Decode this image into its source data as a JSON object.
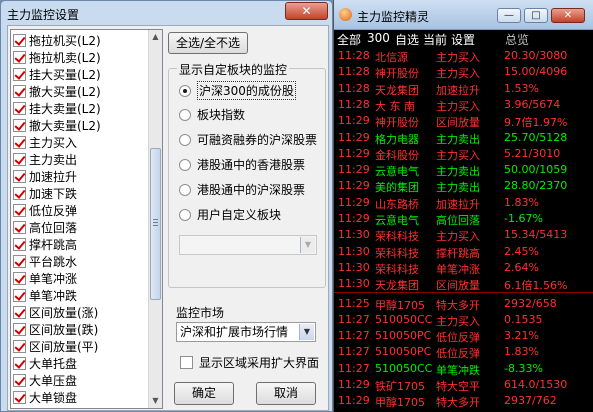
{
  "dialog": {
    "title": "主力监控设置",
    "close_glyph": "✕",
    "checklist": [
      {
        "label": "拖拉机买(L2)",
        "checked": true
      },
      {
        "label": "拖拉机卖(L2)",
        "checked": true
      },
      {
        "label": "挂大买量(L2)",
        "checked": true
      },
      {
        "label": "撤大买量(L2)",
        "checked": true
      },
      {
        "label": "挂大卖量(L2)",
        "checked": true
      },
      {
        "label": "撤大卖量(L2)",
        "checked": true
      },
      {
        "label": "主力买入",
        "checked": true
      },
      {
        "label": "主力卖出",
        "checked": true
      },
      {
        "label": "加速拉升",
        "checked": true
      },
      {
        "label": "加速下跌",
        "checked": true
      },
      {
        "label": "低位反弹",
        "checked": true
      },
      {
        "label": "高位回落",
        "checked": true
      },
      {
        "label": "撑杆跳高",
        "checked": true
      },
      {
        "label": "平台跳水",
        "checked": true
      },
      {
        "label": "单笔冲涨",
        "checked": true
      },
      {
        "label": "单笔冲跌",
        "checked": true
      },
      {
        "label": "区间放量(涨)",
        "checked": true
      },
      {
        "label": "区间放量(跌)",
        "checked": true
      },
      {
        "label": "区间放量(平)",
        "checked": true
      },
      {
        "label": "大单托盘",
        "checked": true
      },
      {
        "label": "大单压盘",
        "checked": true
      },
      {
        "label": "大单锁盘",
        "checked": true
      }
    ],
    "select_all_button": "全选/全不选",
    "block_group": {
      "title": "显示自定板块的监控",
      "options": [
        {
          "label": "沪深300的成份股",
          "selected": true
        },
        {
          "label": "板块指数",
          "selected": false
        },
        {
          "label": "可融资融券的沪深股票",
          "selected": false
        },
        {
          "label": "港股通中的香港股票",
          "selected": false
        },
        {
          "label": "港股通中的沪深股票",
          "selected": false
        },
        {
          "label": "用户自定义板块",
          "selected": false
        }
      ],
      "custom_block_value": ""
    },
    "market": {
      "label": "监控市场",
      "value": "沪深和扩展市场行情"
    },
    "enlarge_checkbox": {
      "label": "显示区域采用扩大界面",
      "checked": false
    },
    "ok_button": "确定",
    "cancel_button": "取消"
  },
  "monitor": {
    "title": "主力监控精灵",
    "min_glyph": "—",
    "max_glyph": "□",
    "close_glyph": "✕",
    "tabs": [
      "全部",
      "300",
      "自选",
      "当前",
      "设置"
    ],
    "column_header": "总览",
    "rows": [
      {
        "time": "11:28",
        "name": "北信源",
        "signal": "主力买入",
        "value": "20.30/3080",
        "color": "red"
      },
      {
        "time": "11:28",
        "name": "神开股份",
        "signal": "主力买入",
        "value": "15.00/4096",
        "color": "red"
      },
      {
        "time": "11:28",
        "name": "天龙集团",
        "signal": "加速拉升",
        "value": "1.53%",
        "color": "red"
      },
      {
        "time": "11:28",
        "name": "大 东 南",
        "signal": "主力买入",
        "value": "3.96/5674",
        "color": "red"
      },
      {
        "time": "11:29",
        "name": "神开股份",
        "signal": "区间放量",
        "value": "9.7倍1.97%",
        "color": "red"
      },
      {
        "time": "11:29",
        "name": "格力电器",
        "signal": "主力卖出",
        "value": "25.70/5128",
        "color": "green"
      },
      {
        "time": "11:29",
        "name": "金科股份",
        "signal": "主力买入",
        "value": "5.21/3010",
        "color": "red"
      },
      {
        "time": "11:29",
        "name": "云意电气",
        "signal": "主力卖出",
        "value": "50.00/1059",
        "color": "green"
      },
      {
        "time": "11:29",
        "name": "美的集团",
        "signal": "主力卖出",
        "value": "28.80/2370",
        "color": "green"
      },
      {
        "time": "11:29",
        "name": "山东路桥",
        "signal": "加速拉升",
        "value": "1.83%",
        "color": "red"
      },
      {
        "time": "11:29",
        "name": "云意电气",
        "signal": "高位回落",
        "value": "-1.67%",
        "color": "green"
      },
      {
        "time": "11:30",
        "name": "荣科科技",
        "signal": "主力买入",
        "value": "15.34/5413",
        "color": "red"
      },
      {
        "time": "11:30",
        "name": "荣科科技",
        "signal": "撑杆跳高",
        "value": "2.45%",
        "color": "red"
      },
      {
        "time": "11:30",
        "name": "荣科科技",
        "signal": "单笔冲涨",
        "value": "2.64%",
        "color": "red"
      },
      {
        "time": "11:30",
        "name": "天龙集团",
        "signal": "区间放量",
        "value": "6.1倍1.56%",
        "color": "red"
      },
      {
        "time": "11:25",
        "name": "甲醇1705",
        "signal": "特大多开",
        "value": "2932/658",
        "color": "red"
      },
      {
        "time": "11:27",
        "name": "510050CC",
        "signal": "主力买入",
        "value": "0.1535",
        "color": "red"
      },
      {
        "time": "11:27",
        "name": "510050PC",
        "signal": "低位反弹",
        "value": "3.21%",
        "color": "red"
      },
      {
        "time": "11:27",
        "name": "510050PC",
        "signal": "低位反弹",
        "value": "1.83%",
        "color": "red"
      },
      {
        "time": "11:27",
        "name": "510050CC",
        "signal": "单笔冲跌",
        "value": "-8.33%",
        "color": "green"
      },
      {
        "time": "11:29",
        "name": "铁矿1705",
        "signal": "特大空平",
        "value": "614.0/1530",
        "color": "red"
      },
      {
        "time": "11:29",
        "name": "甲醇1705",
        "signal": "特大多开",
        "value": "2937/762",
        "color": "red"
      }
    ]
  }
}
